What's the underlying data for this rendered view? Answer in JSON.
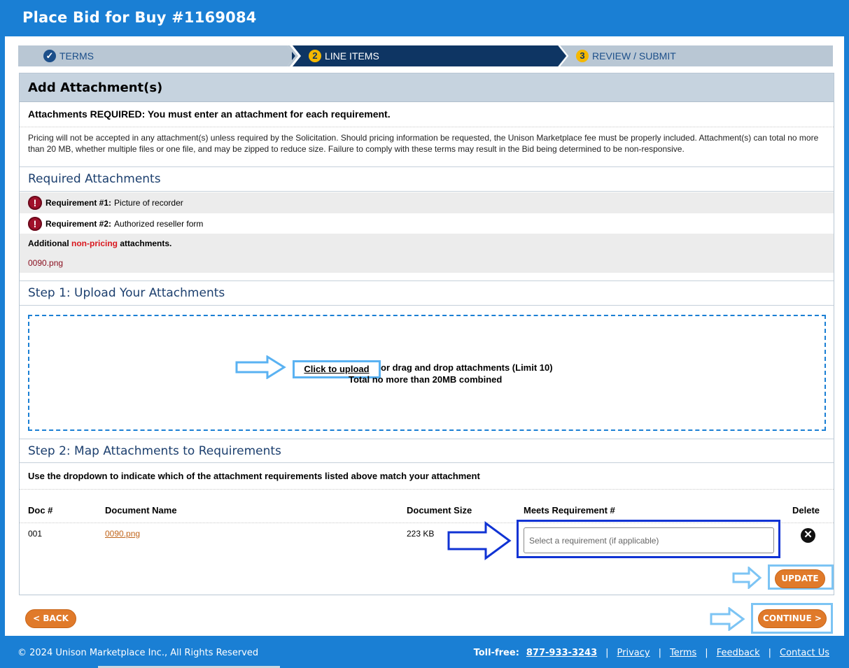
{
  "header": {
    "title": "Place Bid for Buy #1169084"
  },
  "steps": [
    {
      "num": "✓",
      "label": "TERMS"
    },
    {
      "num": "2",
      "label": "LINE ITEMS"
    },
    {
      "num": "3",
      "label": "REVIEW / SUBMIT"
    }
  ],
  "panel": {
    "title": "Add Attachment(s)",
    "required_note": "Attachments REQUIRED: You must enter an attachment for each requirement.",
    "pricing_note": "Pricing will not be accepted in any attachment(s) unless required by the Solicitation. Should pricing information be requested, the Unison Marketplace fee must be properly included. Attachment(s) can total no more than 20 MB, whether multiple files or one file, and may be zipped to reduce size. Failure to comply with these terms may result in the Bid being determined to be non-responsive.",
    "required_title": "Required Attachments",
    "requirements": [
      {
        "label": "Requirement #1:",
        "text": "Picture of recorder"
      },
      {
        "label": "Requirement #2:",
        "text": "Authorized reseller form"
      }
    ],
    "additional": {
      "prefix": "Additional",
      "highlight": "non-pricing",
      "suffix": "attachments.",
      "file": "0090.png"
    },
    "step1_title": "Step 1: Upload Your Attachments",
    "upload": {
      "link": "Click to upload",
      "rest": "or drag and drop attachments (Limit 10)",
      "limit": "Total no more than 20MB combined"
    },
    "step2_title": "Step 2: Map Attachments to Requirements",
    "step2_note": "Use the dropdown to indicate which of the attachment requirements listed above match your attachment",
    "table": {
      "headers": {
        "doc": "Doc #",
        "name": "Document Name",
        "size": "Document Size",
        "meets": "Meets Requirement #",
        "delete": "Delete"
      },
      "row": {
        "doc": "001",
        "name": "0090.png",
        "size": "223 KB",
        "placeholder": "Select a requirement (if applicable)"
      }
    },
    "update_label": "UPDATE"
  },
  "nav": {
    "back_label": "< BACK",
    "continue_label": "CONTINUE >"
  },
  "footer": {
    "copyright": "© 2024 Unison Marketplace Inc., All Rights Reserved",
    "tollfree_label": "Toll-free:",
    "phone": "877-933-3243",
    "links": [
      "Privacy",
      "Terms",
      "Feedback",
      "Contact Us"
    ]
  },
  "colors": {
    "brand_blue": "#1a7fd4",
    "active_step": "#0e3563",
    "button_orange": "#e07a2a",
    "alert_red": "#a0102a"
  },
  "icons": [
    "checkmark-icon",
    "alert-icon",
    "close-circle-icon",
    "arrow-right-icon"
  ]
}
